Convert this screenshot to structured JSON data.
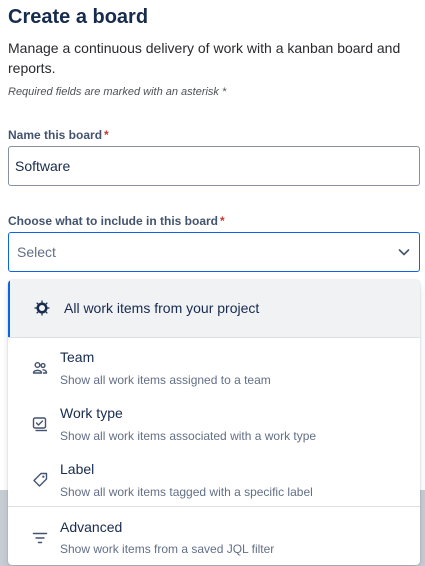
{
  "header": {
    "title": "Create a board",
    "description": "Manage a continuous delivery of work with a kanban board and reports.",
    "required_note": "Required fields are marked with an asterisk *"
  },
  "name_field": {
    "label": "Name this board",
    "asterisk": "*",
    "value": "Software"
  },
  "include_field": {
    "label": "Choose what to include in this board",
    "asterisk": "*",
    "placeholder": "Select",
    "chevron_icon": "chevron-down-icon"
  },
  "menu": {
    "options": [
      {
        "label": "All work items from your project",
        "icon": "project-icon",
        "selected": true
      },
      {
        "label": "Team",
        "sub": "Show all work items assigned to a team",
        "icon": "team-icon"
      },
      {
        "label": "Work type",
        "sub": "Show all work items associated with a work type",
        "icon": "work-type-icon"
      },
      {
        "label": "Label",
        "sub": "Show all work items tagged with a specific label",
        "icon": "tag-icon"
      },
      {
        "label": "Advanced",
        "sub": "Show work items from a saved JQL filter",
        "icon": "filter-icon"
      }
    ]
  },
  "colors": {
    "accent": "#0c66e4",
    "required": "#c9372c",
    "selected_bg": "#f1f2f4"
  }
}
